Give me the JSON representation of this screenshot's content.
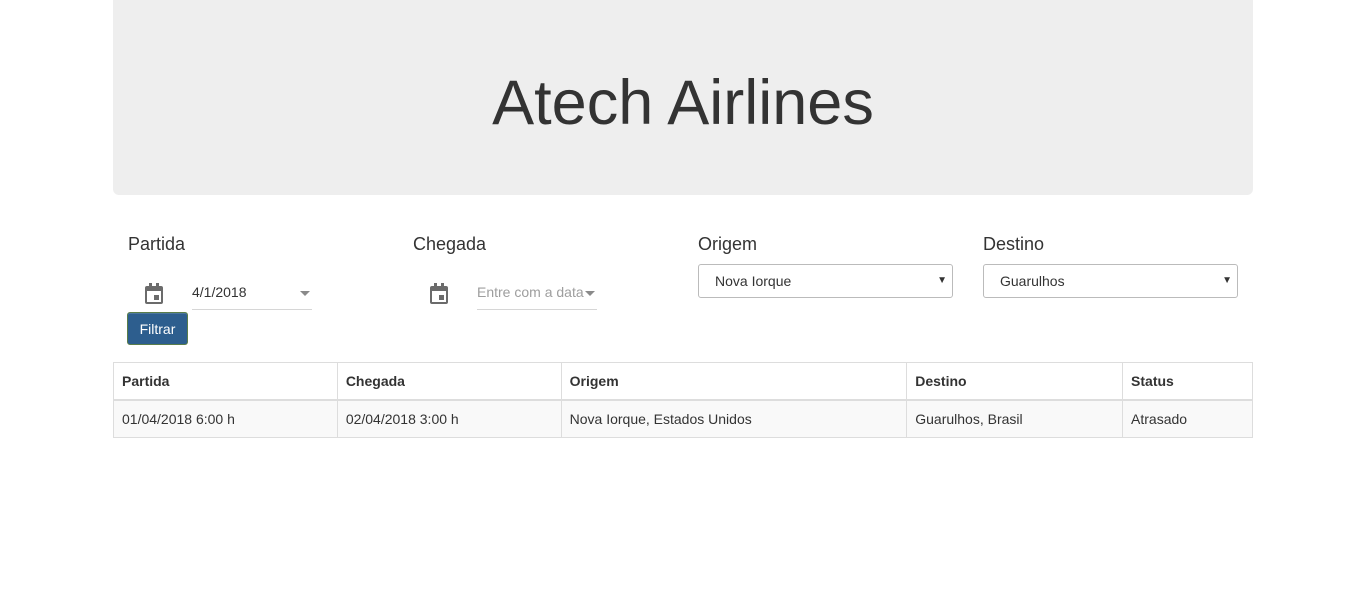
{
  "header": {
    "title": "Atech Airlines"
  },
  "filters": {
    "partida": {
      "label": "Partida",
      "value": "4/1/2018"
    },
    "chegada": {
      "label": "Chegada",
      "placeholder": "Entre com a data"
    },
    "origem": {
      "label": "Origem",
      "selected": "Nova Iorque"
    },
    "destino": {
      "label": "Destino",
      "selected": "Guarulhos"
    },
    "filter_button": "Filtrar"
  },
  "table": {
    "columns": [
      "Partida",
      "Chegada",
      "Origem",
      "Destino",
      "Status"
    ],
    "rows": [
      [
        "01/04/2018 6:00 h",
        "02/04/2018 3:00 h",
        "Nova Iorque, Estados Unidos",
        "Guarulhos, Brasil",
        "Atrasado"
      ]
    ]
  },
  "icons": {
    "date_picker": "calendar-icon",
    "dropdown": "chevron-down-icon"
  },
  "colors": {
    "jumbotron_bg": "#eeeeee",
    "button_bg": "#2d5e8e",
    "button_text": "#ffffff",
    "table_row_bg": "#f9f9f9"
  }
}
